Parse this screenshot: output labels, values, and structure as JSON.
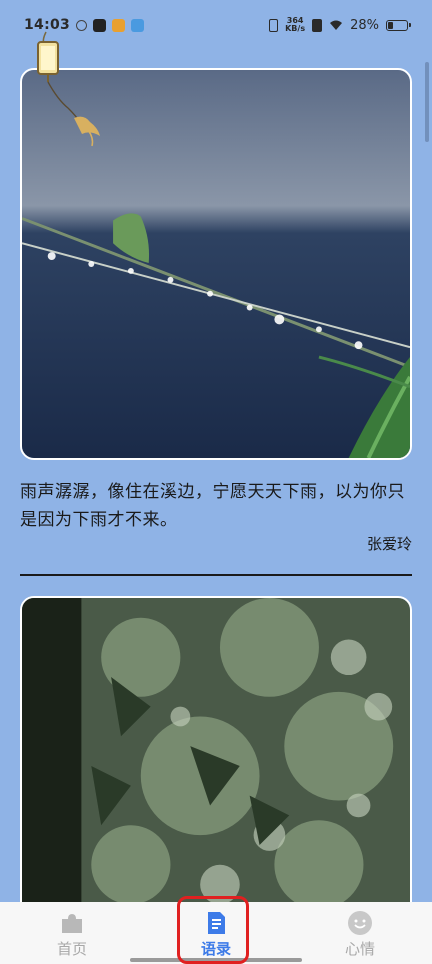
{
  "status_bar": {
    "time": "14:03",
    "net_speed_value": "364",
    "net_speed_unit": "KB/s",
    "battery": "28%",
    "battery_level": 0.28
  },
  "feed": {
    "items": [
      {
        "image": "rain-grass-droplets",
        "quote": "雨声潺潺，像住在溪边，宁愿天天下雨，以为你只是因为下雨才不来。",
        "author": "张爱玲"
      },
      {
        "image": "rain-green-leaves"
      }
    ]
  },
  "bottom_nav": {
    "items": [
      {
        "label": "首页",
        "icon": "puzzle-icon",
        "active": false
      },
      {
        "label": "语录",
        "icon": "document-icon",
        "active": true
      },
      {
        "label": "心情",
        "icon": "smiley-icon",
        "active": false
      }
    ]
  },
  "colors": {
    "background": "#8fb3e6",
    "accent": "#3d7be8",
    "highlight": "#e02020",
    "nav_inactive": "#a8a8a8"
  }
}
